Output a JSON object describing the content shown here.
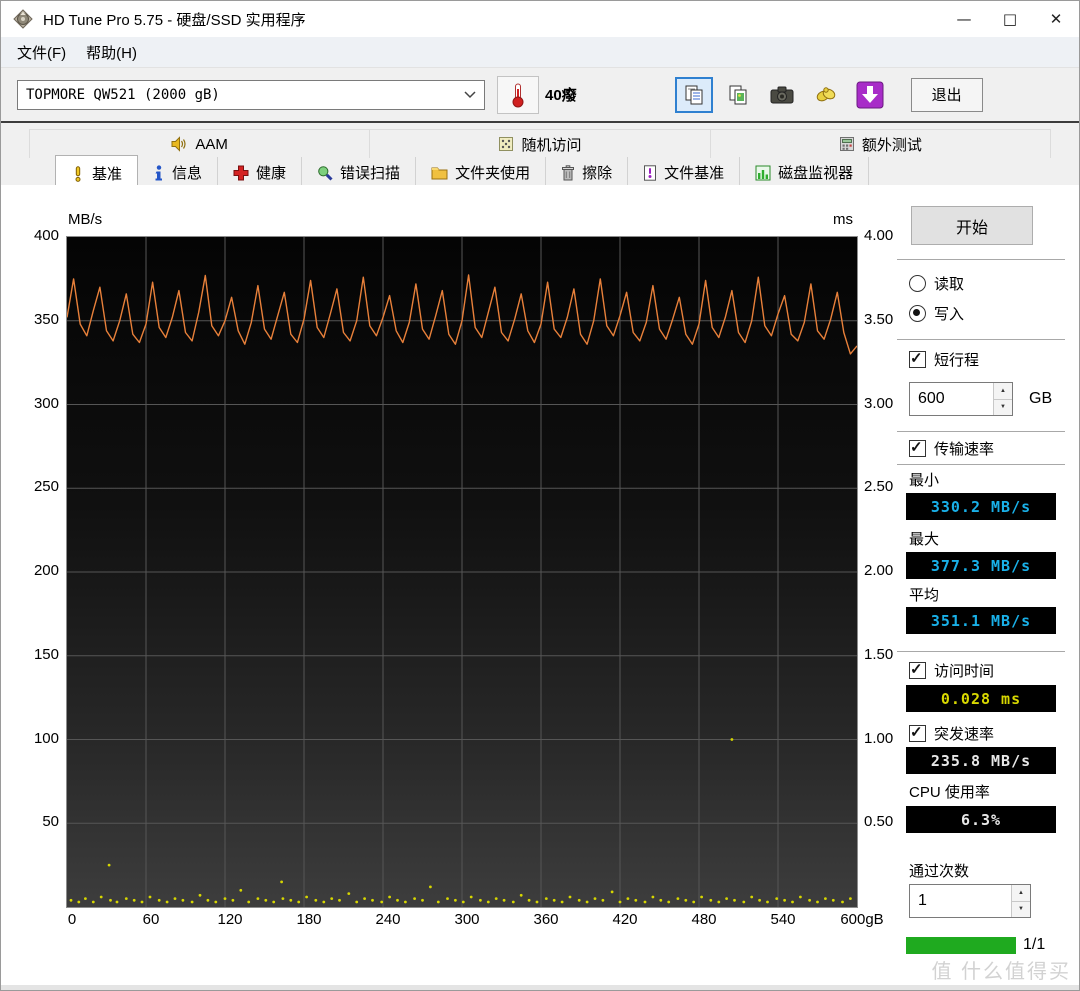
{
  "window": {
    "title": "HD Tune Pro 5.75 - 硬盘/SSD 实用程序",
    "minimize": "—",
    "maximize": "□",
    "close": "✕"
  },
  "menu": {
    "file": "文件(F)",
    "help": "帮助(H)"
  },
  "toolbar": {
    "drive_select": "TOPMORE QW521 (2000 gB)",
    "temperature": "40癈",
    "exit_label": "退出"
  },
  "tabs_top": [
    {
      "label": "AAM"
    },
    {
      "label": "随机访问"
    },
    {
      "label": "额外测试"
    }
  ],
  "tabs_bottom": [
    {
      "label": "基准",
      "active": true
    },
    {
      "label": "信息"
    },
    {
      "label": "健康"
    },
    {
      "label": "错误扫描"
    },
    {
      "label": "文件夹使用"
    },
    {
      "label": "擦除"
    },
    {
      "label": "文件基准"
    },
    {
      "label": "磁盘监视器"
    }
  ],
  "panel": {
    "start_label": "开始",
    "radio_read": "读取",
    "radio_write": "写入",
    "short_stroke_label": "短行程",
    "short_stroke_value": "600",
    "unit_gb": "GB",
    "transfer_rate_label": "传输速率",
    "min_label": "最小",
    "min_value": "330.2 MB/s",
    "max_label": "最大",
    "max_value": "377.3 MB/s",
    "avg_label": "平均",
    "avg_value": "351.1 MB/s",
    "access_time_label": "访问时间",
    "access_time_value": "0.028 ms",
    "burst_label": "突发速率",
    "burst_value": "235.8 MB/s",
    "cpu_label": "CPU 使用率",
    "cpu_value": "6.3%",
    "pass_count_label": "通过次数",
    "pass_count_value": "1",
    "progress_text": "1/1"
  },
  "footer": {
    "watermark": "值 什么值得买"
  },
  "chart_data": {
    "type": "line",
    "title": "HD Tune Pro write benchmark - transfer rate vs position with access-time scatter",
    "grid": true,
    "grid_color": "#565656",
    "left_axis": {
      "label": "MB/s",
      "min": 0,
      "max": 400,
      "ticks": [
        400,
        350,
        300,
        250,
        200,
        150,
        100,
        50
      ]
    },
    "right_axis": {
      "label": "ms",
      "min": 0,
      "max": 4,
      "ticks": [
        "4.00",
        "3.50",
        "3.00",
        "2.50",
        "2.00",
        "1.50",
        "1.00",
        "0.50"
      ]
    },
    "x_axis": {
      "min": 0,
      "max": 600,
      "tick_step": 60,
      "tick_labels": [
        "0",
        "60",
        "120",
        "180",
        "240",
        "300",
        "360",
        "420",
        "480",
        "540",
        "600gB"
      ]
    },
    "series": [
      {
        "name": "transfer-rate-write",
        "color": "#e8803a",
        "x_step": 5,
        "unit": "MB/s",
        "values": [
          352,
          375,
          348,
          341,
          356,
          370,
          344,
          338,
          350,
          366,
          342,
          337,
          348,
          373,
          346,
          340,
          352,
          368,
          343,
          338,
          355,
          377,
          347,
          341,
          350,
          364,
          344,
          336,
          349,
          371,
          345,
          339,
          353,
          367,
          342,
          337,
          351,
          374,
          346,
          340,
          354,
          369,
          343,
          338,
          350,
          376,
          347,
          341,
          352,
          365,
          344,
          337,
          349,
          372,
          345,
          339,
          353,
          368,
          342,
          336,
          350,
          377.3,
          346,
          340,
          355,
          370,
          343,
          338,
          351,
          366,
          344,
          337,
          348,
          373,
          345,
          340,
          352,
          369,
          342,
          336,
          350,
          375,
          347,
          341,
          353,
          367,
          343,
          338,
          349,
          371,
          345,
          339,
          351,
          364,
          342,
          336,
          348,
          374,
          346,
          340,
          352,
          368,
          343,
          337,
          350,
          376,
          347,
          341,
          354,
          365,
          342,
          338,
          349,
          372,
          344,
          339,
          351,
          367,
          343,
          330.2,
          335
        ]
      }
    ],
    "scatter": {
      "name": "access-time",
      "color": "#d6d600",
      "unit": "ms",
      "points": [
        [
          3,
          0.04
        ],
        [
          9,
          0.03
        ],
        [
          14,
          0.05
        ],
        [
          20,
          0.03
        ],
        [
          26,
          0.06
        ],
        [
          32,
          0.25
        ],
        [
          33,
          0.04
        ],
        [
          38,
          0.03
        ],
        [
          45,
          0.05
        ],
        [
          51,
          0.04
        ],
        [
          57,
          0.03
        ],
        [
          63,
          0.06
        ],
        [
          70,
          0.04
        ],
        [
          76,
          0.03
        ],
        [
          82,
          0.05
        ],
        [
          88,
          0.04
        ],
        [
          95,
          0.03
        ],
        [
          101,
          0.07
        ],
        [
          107,
          0.04
        ],
        [
          113,
          0.03
        ],
        [
          120,
          0.05
        ],
        [
          126,
          0.04
        ],
        [
          132,
          0.1
        ],
        [
          138,
          0.03
        ],
        [
          145,
          0.05
        ],
        [
          151,
          0.04
        ],
        [
          157,
          0.03
        ],
        [
          163,
          0.15
        ],
        [
          164,
          0.05
        ],
        [
          170,
          0.04
        ],
        [
          176,
          0.03
        ],
        [
          182,
          0.06
        ],
        [
          189,
          0.04
        ],
        [
          195,
          0.03
        ],
        [
          201,
          0.05
        ],
        [
          207,
          0.04
        ],
        [
          214,
          0.08
        ],
        [
          220,
          0.03
        ],
        [
          226,
          0.05
        ],
        [
          232,
          0.04
        ],
        [
          239,
          0.03
        ],
        [
          245,
          0.06
        ],
        [
          251,
          0.04
        ],
        [
          257,
          0.03
        ],
        [
          264,
          0.05
        ],
        [
          270,
          0.04
        ],
        [
          276,
          0.12
        ],
        [
          282,
          0.03
        ],
        [
          289,
          0.05
        ],
        [
          295,
          0.04
        ],
        [
          301,
          0.03
        ],
        [
          307,
          0.06
        ],
        [
          314,
          0.04
        ],
        [
          320,
          0.03
        ],
        [
          326,
          0.05
        ],
        [
          332,
          0.04
        ],
        [
          339,
          0.03
        ],
        [
          345,
          0.07
        ],
        [
          351,
          0.04
        ],
        [
          357,
          0.03
        ],
        [
          364,
          0.05
        ],
        [
          370,
          0.04
        ],
        [
          376,
          0.03
        ],
        [
          382,
          0.06
        ],
        [
          389,
          0.04
        ],
        [
          395,
          0.03
        ],
        [
          401,
          0.05
        ],
        [
          407,
          0.04
        ],
        [
          414,
          0.09
        ],
        [
          420,
          0.03
        ],
        [
          426,
          0.05
        ],
        [
          432,
          0.04
        ],
        [
          439,
          0.03
        ],
        [
          445,
          0.06
        ],
        [
          451,
          0.04
        ],
        [
          457,
          0.03
        ],
        [
          464,
          0.05
        ],
        [
          470,
          0.04
        ],
        [
          476,
          0.03
        ],
        [
          482,
          0.06
        ],
        [
          489,
          0.04
        ],
        [
          495,
          0.03
        ],
        [
          501,
          0.05
        ],
        [
          505,
          1.0
        ],
        [
          507,
          0.04
        ],
        [
          514,
          0.03
        ],
        [
          520,
          0.06
        ],
        [
          526,
          0.04
        ],
        [
          532,
          0.03
        ],
        [
          539,
          0.05
        ],
        [
          545,
          0.04
        ],
        [
          551,
          0.03
        ],
        [
          557,
          0.06
        ],
        [
          564,
          0.04
        ],
        [
          570,
          0.03
        ],
        [
          576,
          0.05
        ],
        [
          582,
          0.04
        ],
        [
          589,
          0.03
        ],
        [
          595,
          0.05
        ]
      ]
    }
  }
}
